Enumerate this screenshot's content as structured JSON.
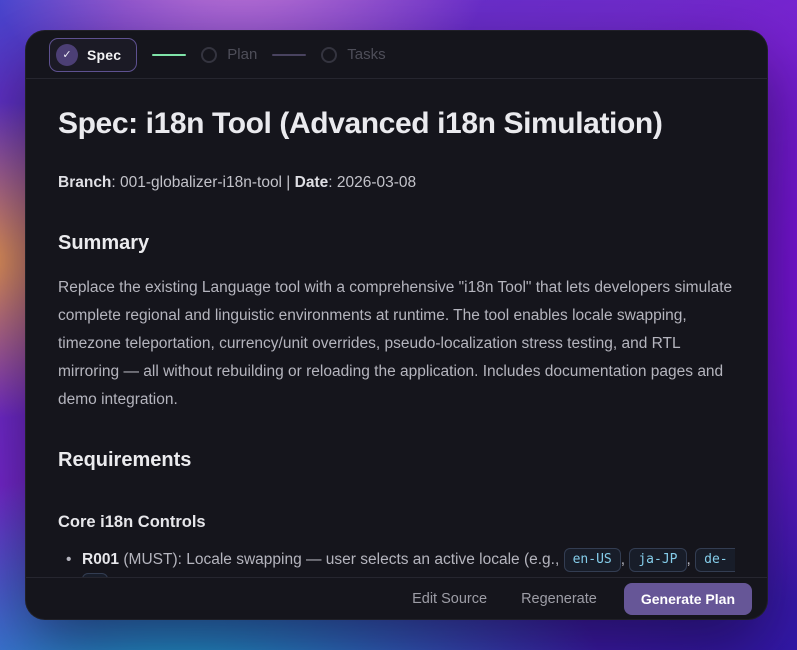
{
  "stepper": {
    "steps": [
      {
        "label": "Spec",
        "state": "active",
        "icon": "check"
      },
      {
        "label": "Plan",
        "state": "pending",
        "icon": "circle"
      },
      {
        "label": "Tasks",
        "state": "pending",
        "icon": "circle"
      }
    ],
    "check_glyph": "✓"
  },
  "document": {
    "title": "Spec: i18n Tool (Advanced i18n Simulation)",
    "meta": {
      "branch_label": "Branch",
      "branch_value": ": 001-globalizer-i18n-tool | ",
      "date_label": "Date",
      "date_value": ": 2026-03-08"
    },
    "summary": {
      "heading": "Summary",
      "body": "Replace the existing Language tool with a comprehensive \"i18n Tool\" that lets developers simulate complete regional and linguistic environments at runtime. The tool enables locale swapping, timezone teleportation, currency/unit overrides, pseudo-localization stress testing, and RTL mirroring — all without rebuilding or reloading the application. Includes documentation pages and demo integration."
    },
    "requirements": {
      "heading": "Requirements",
      "subheading": "Core i18n Controls",
      "item": {
        "bullet": "•",
        "id": "R001",
        "text_after_id": " (MUST): Locale swapping — user selects an active locale (e.g., ",
        "code_1": "en-US",
        "sep_1": ", ",
        "code_2": "ja-JP",
        "sep_2": ", ",
        "code_3_clipped": "de-"
      }
    }
  },
  "footer": {
    "edit_source_label": "Edit Source",
    "regenerate_label": "Regenerate",
    "generate_plan_label": "Generate Plan"
  },
  "colors": {
    "modal_background": "#15151c",
    "accent_button_purple": "#665697",
    "active_step_border_purple": "#5e5190",
    "connector_done_green": "#7fe3a8",
    "connector_todo_gray": "#49435f",
    "code_text_blue": "#85cdea",
    "heading_text": "#ebebee",
    "body_text": "#b5b5be",
    "background_gradient_stops": [
      "#3c4ed2",
      "#cd7fd9",
      "#ec9a50",
      "#17b9dc",
      "#7b11d8",
      "#3318ab"
    ]
  }
}
